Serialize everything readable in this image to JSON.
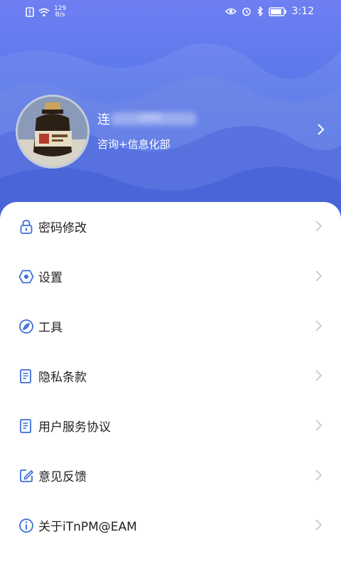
{
  "status_bar": {
    "net_speed_value": "129",
    "net_speed_unit": "B/s",
    "time": "3:12"
  },
  "profile": {
    "name": "连",
    "name_masked": "1800",
    "department": "咨询+信息化部"
  },
  "menu": {
    "items": [
      {
        "label": "密码修改",
        "icon": "lock-icon"
      },
      {
        "label": "设置",
        "icon": "settings-hexagon-icon"
      },
      {
        "label": "工具",
        "icon": "compass-icon"
      },
      {
        "label": "隐私条款",
        "icon": "document-icon"
      },
      {
        "label": "用户服务协议",
        "icon": "document-icon"
      },
      {
        "label": "意见反馈",
        "icon": "edit-icon"
      },
      {
        "label": "关于iTnPM@EAM",
        "icon": "info-icon"
      }
    ]
  },
  "colors": {
    "header_gradient_top": "#6f7ff2",
    "header_gradient_bottom": "#4e72e6",
    "icon_blue": "#3b6fd8",
    "text": "#222222",
    "chevron": "#c8c8c8"
  }
}
